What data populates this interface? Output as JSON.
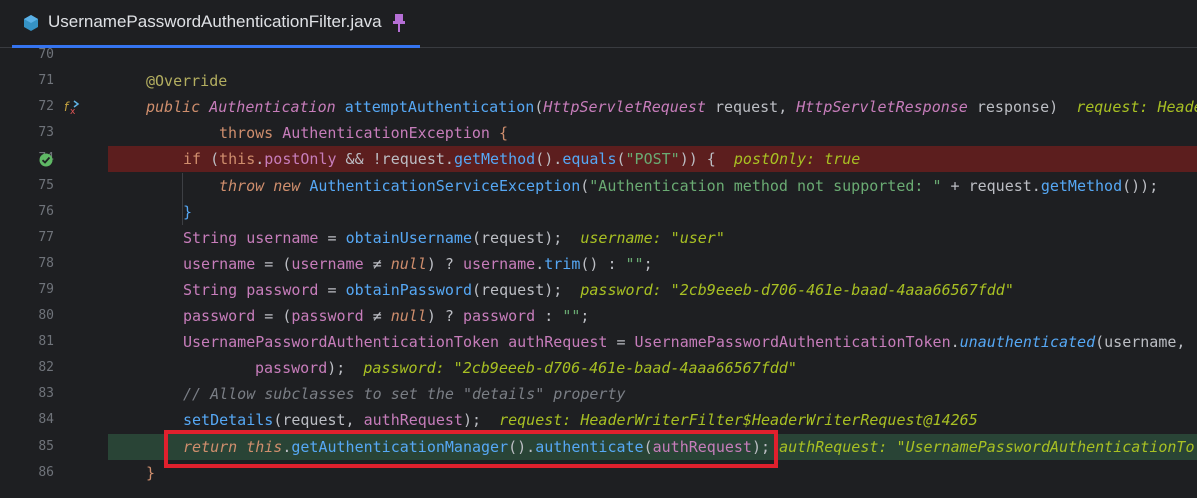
{
  "tab": {
    "title": "UsernamePasswordAuthenticationFilter.java",
    "icon": "java-class-icon",
    "pin_icon": "pin-icon"
  },
  "line_numbers": [
    "70",
    "71",
    "72",
    "73",
    "74",
    "75",
    "76",
    "77",
    "78",
    "79",
    "80",
    "81",
    "82",
    "83",
    "84",
    "85",
    "86"
  ],
  "gutter_icons": {
    "72": "override-method-icon",
    "74": "breakpoint-check-icon"
  },
  "code": {
    "l70": "",
    "l71": {
      "annotation": "@Override"
    },
    "l72": {
      "kw_public": "public",
      "type": "Authentication",
      "method": "attemptAuthentication",
      "p1type": "HttpServletRequest",
      "p1": "request",
      "p2type": "HttpServletResponse",
      "p2": "response",
      "hint": "request: HeaderWr"
    },
    "l73": {
      "throws": "throws",
      "exc": "AuthenticationException",
      "brace": "{"
    },
    "l74": {
      "if": "if",
      "this": "this",
      "field": "postOnly",
      "rest1": " && !request.",
      "getMethod": "getMethod",
      "rest2": "().",
      "equals": "equals",
      "str": "\"POST\"",
      "rest3": ")) {",
      "hint": "postOnly: true"
    },
    "l75": {
      "throw": "throw",
      "new": "new",
      "cls": "AuthenticationServiceException",
      "str": "\"Authentication method not supported: \"",
      "plus": " + request.",
      "getMethod": "getMethod",
      "end": "());"
    },
    "l76": "}",
    "l77": {
      "type": "String",
      "var": "username",
      "eq": " = ",
      "fn": "obtainUsername",
      "args": "(request);",
      "hint": "username: \"user\""
    },
    "l78": {
      "var": "username",
      "mid": " = (",
      "var2": "username",
      "ne": " ≠ ",
      "null": "null",
      "q": ") ? ",
      "var3": "username",
      "dot": ".",
      "trim": "trim",
      "tail": "() : ",
      "str": "\"\"",
      "end": ";"
    },
    "l79": {
      "type": "String",
      "var": "password",
      "eq": " = ",
      "fn": "obtainPassword",
      "args": "(request);",
      "hint": "password: \"2cb9eeeb-d706-461e-baad-4aaa66567fdd\""
    },
    "l80": {
      "var": "password",
      "mid": " = (",
      "var2": "password",
      "ne": " ≠ ",
      "null": "null",
      "q": ") ? ",
      "var3": "password",
      "tail": " : ",
      "str": "\"\"",
      "end": ";"
    },
    "l81": {
      "type": "UsernamePasswordAuthenticationToken",
      "var": "authRequest",
      "eq": " = ",
      "cls": "UsernamePasswordAuthenticationToken",
      "dot": ".",
      "fn": "unauthenticated",
      "args": "(username,"
    },
    "l82": {
      "arg": "password",
      "end": ");",
      "hint": "password: \"2cb9eeeb-d706-461e-baad-4aaa66567fdd\""
    },
    "l83": {
      "comment": "// Allow subclasses to set the \"details\" property"
    },
    "l84": {
      "fn": "setDetails",
      "open": "(request, ",
      "arg": "authRequest",
      "end": ");",
      "hint": "request: HeaderWriterFilter$HeaderWriterRequest@14265"
    },
    "l85": {
      "return": "return",
      "this": "this",
      "dot1": ".",
      "fn1": "getAuthenticationManager",
      "mid": "().",
      "fn2": "authenticate",
      "open": "(",
      "arg": "authRequest",
      "end": ");",
      "hint": "authRequest: \"UsernamePasswordAuthenticationTo"
    },
    "l86": "}"
  },
  "colors": {
    "breakpoint_line": "#5c1e1e",
    "execution_line": "#294436",
    "highlight_box": "#e0202d",
    "tab_underline": "#3574f0"
  }
}
